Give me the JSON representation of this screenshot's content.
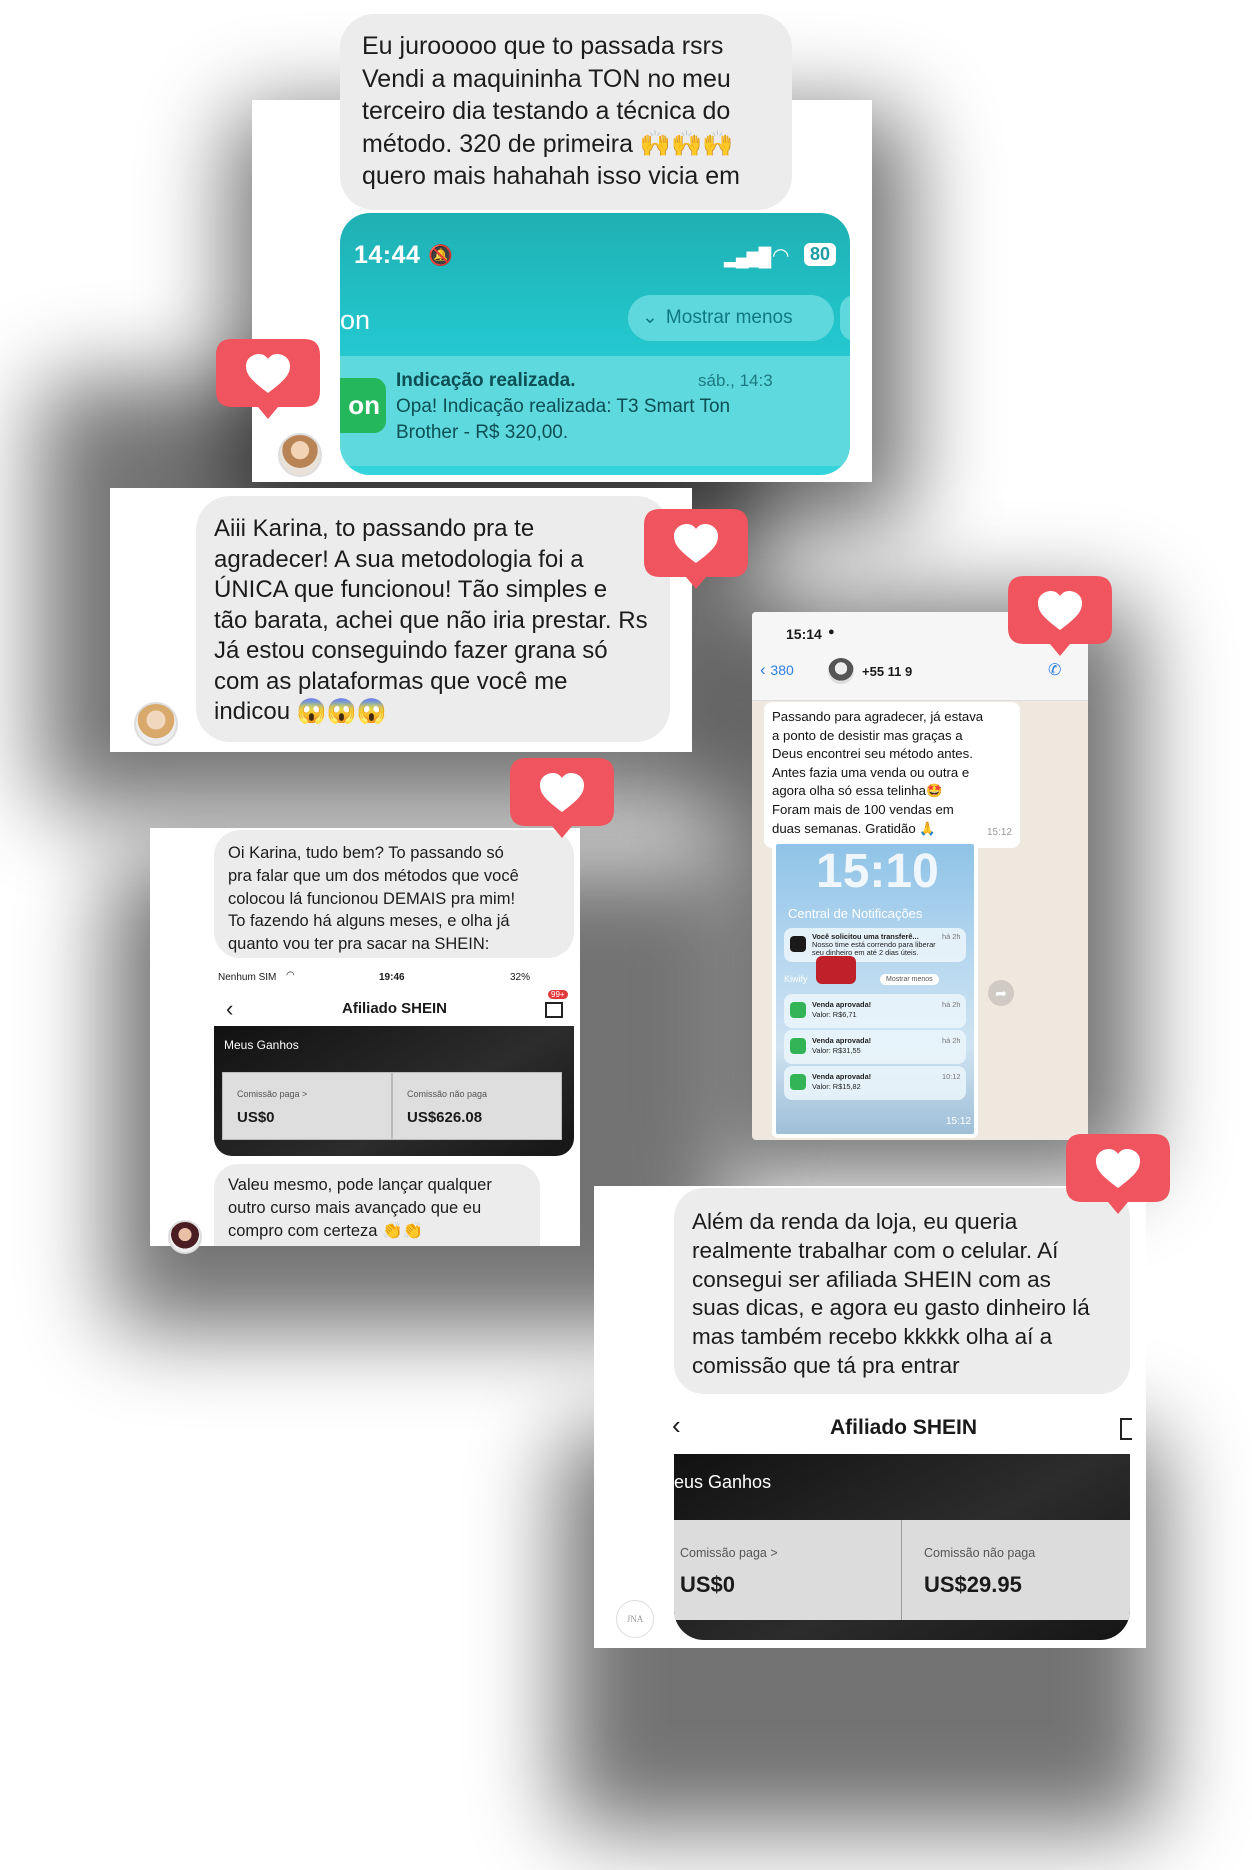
{
  "testimonial_1": {
    "message_lines": [
      "Eu jurooooo que to passada rsrs",
      "Vendi a maquininha TON no meu",
      "terceiro dia testando a técnica do",
      "método. 320 de primeira 🙌🙌🙌",
      "quero mais hahahah isso vicia em"
    ],
    "status_time": "14:44",
    "battery": "80",
    "app_name_partial": "on",
    "show_less_button": "Mostrar menos",
    "notification_title": "Indicação realizada.",
    "notification_time": "sáb., 14:3",
    "notification_body_1": "Opa! Indicação realizada: T3 Smart Ton",
    "notification_body_2": "Brother - R$ 320,00.",
    "logo_text": "on"
  },
  "testimonial_2": {
    "message_lines": [
      "Aiii Karina, to passando pra te",
      "agradecer! A sua metodologia foi a",
      "ÚNICA que funcionou! Tão simples e",
      "tão barata, achei que não iria prestar. Rs",
      "Já estou conseguindo fazer grana só",
      "com as plataformas que você me",
      "indicou 😱😱😱"
    ]
  },
  "testimonial_3": {
    "status_time": "15:14",
    "back_count": "380",
    "contact": "+55 11 9",
    "message_lines": [
      "Passando para agradecer, já estava",
      "a ponto de desistir mas graças a",
      "Deus encontrei seu método antes.",
      "Antes fazia uma venda ou outra e",
      "agora olha só essa telinha🤩",
      "Foram mais de 100 vendas em",
      "duas semanas. Gratidão 🙏"
    ],
    "message_time": "15:12",
    "lock_time": "15:10",
    "notification_center": "Central de Notificações",
    "notif_transfer_title": "Você solicitou uma transferê...",
    "notif_transfer_body": "Nosso time está correndo para liberar seu dinheiro em até 2 dias úteis.",
    "notif_age": "há 2h",
    "show_less": "Mostrar menos",
    "app_label": "Kiwify",
    "sales": [
      {
        "title": "Venda aprovada!",
        "value": "Valor: R$6,71",
        "age": "há 2h"
      },
      {
        "title": "Venda aprovada!",
        "value": "Valor: R$31,55",
        "age": "há 2h"
      },
      {
        "title": "Venda aprovada!",
        "value": "Valor: R$15,82",
        "age": "10:12"
      }
    ],
    "image_time": "15:12"
  },
  "testimonial_4": {
    "message_lines": [
      "Oi Karina, tudo bem? To passando só",
      "pra falar que um dos métodos que você",
      "colocou lá funcionou DEMAIS pra mim!",
      "To fazendo há alguns meses, e olha já",
      "quanto vou ter pra sacar na SHEIN:"
    ],
    "carrier": "Nenhum SIM",
    "status_time": "19:46",
    "battery": "32%",
    "page_title": "Afiliado SHEIN",
    "badge": "99+",
    "section_title": "Meus Ganhos",
    "paid_label": "Comissão paga >",
    "paid_value": "US$0",
    "unpaid_label": "Comissão não paga",
    "unpaid_value": "US$626.08",
    "reply_lines": [
      "Valeu mesmo, pode lançar qualquer",
      "outro curso mais avançado que eu",
      "compro com certeza 👏👏"
    ]
  },
  "testimonial_5": {
    "message_lines": [
      "Além da renda da loja, eu queria",
      "realmente trabalhar com o celular. Aí",
      "consegui ser afiliada SHEIN com as",
      "suas dicas, e agora eu gasto dinheiro lá",
      "mas também recebo kkkkk olha aí a",
      "comissão que tá pra entrar"
    ],
    "page_title": "Afiliado SHEIN",
    "section_title": "eus Ganhos",
    "paid_label": "Comissão paga >",
    "paid_value": "US$0",
    "unpaid_label": "Comissão não paga",
    "unpaid_value": "US$29.95",
    "avatar_text": "JNA"
  },
  "colors": {
    "heart_red": "#f0545e",
    "bubble_gray": "#ececec",
    "ton_teal": "#22c5cb",
    "whatsapp_blue": "#2f7fe0"
  }
}
